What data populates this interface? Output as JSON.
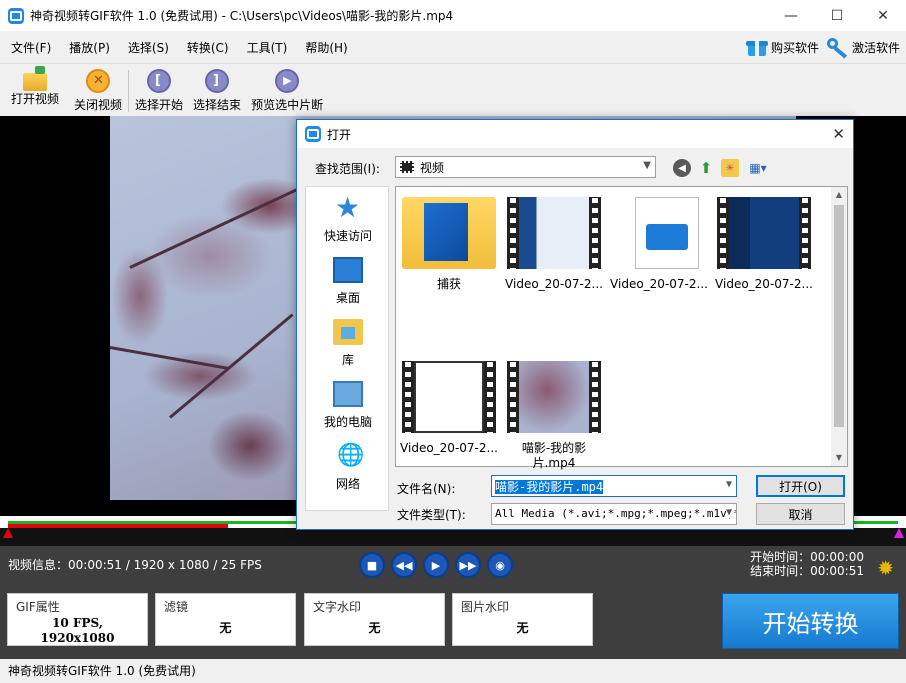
{
  "window": {
    "title": "神奇视频转GIF软件 1.0 (免费试用) - C:\\Users\\pc\\Videos\\喵影-我的影片.mp4",
    "min": "—",
    "max": "☐",
    "close": "✕"
  },
  "menu": {
    "items": [
      "文件(F)",
      "播放(P)",
      "选择(S)",
      "转换(C)",
      "工具(T)",
      "帮助(H)"
    ],
    "buy": "购买软件",
    "activate": "激活软件"
  },
  "toolbar": {
    "open_video": "打开视频",
    "close_video": "关闭视频",
    "select_start": "选择开始",
    "select_end": "选择结束",
    "preview_selection": "预览选中片断"
  },
  "info": {
    "video_info": "视频信息：00:00:51 / 1920 x 1080 / 25 FPS",
    "start_time": "开始时间：00:00:00",
    "end_time": "结束时间：00:00:51"
  },
  "cards": {
    "gif_label": "GIF属性",
    "gif_value_line1": "10 FPS,",
    "gif_value_line2": "1920x1080",
    "filter_label": "滤镜",
    "filter_value": "无",
    "text_wm_label": "文字水印",
    "text_wm_value": "无",
    "image_wm_label": "图片水印",
    "image_wm_value": "无"
  },
  "start_button": "开始转换",
  "status": "神奇视频转GIF软件 1.0 (免费试用)",
  "dialog": {
    "title": "打开",
    "look_in_label": "查找范围(I):",
    "look_in_value": "视频",
    "places": [
      "快速访问",
      "桌面",
      "库",
      "我的电脑",
      "网络"
    ],
    "files": [
      {
        "name": "捕获",
        "kind": "folder"
      },
      {
        "name": "Video_20-07-2...",
        "kind": "film-ui"
      },
      {
        "name": "Video_20-07-2...",
        "kind": "clapper"
      },
      {
        "name": "Video_20-07-2...",
        "kind": "film-dark"
      },
      {
        "name": "Video_20-07-2...",
        "kind": "film-white"
      },
      {
        "name": "喵影-我的影片.mp4",
        "kind": "film-photo"
      }
    ],
    "filename_label": "文件名(N):",
    "filename_value": "喵影-我的影片.mp4",
    "filetype_label": "文件类型(T):",
    "filetype_value": "All Media (*.avi;*.mpg;*.mpeg;*.m1v;*",
    "open_button": "打开(O)",
    "cancel_button": "取消"
  }
}
